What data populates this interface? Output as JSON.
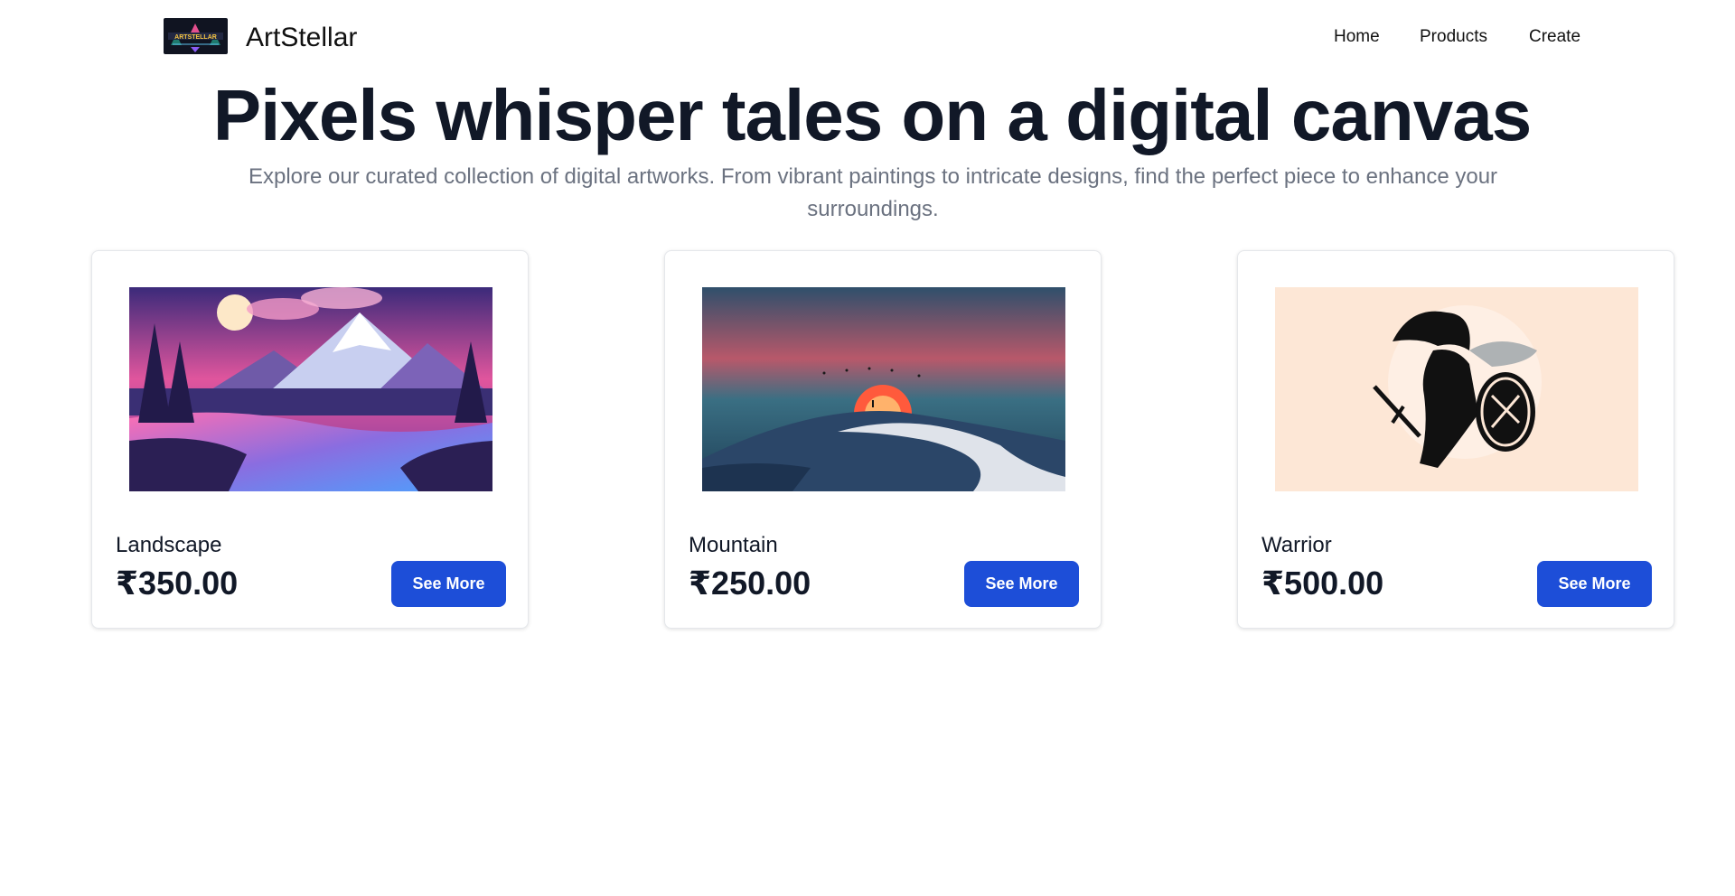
{
  "header": {
    "logo_icon": "artstellar-logo-icon",
    "logo_text": "ARTSTELLAR",
    "brand": "ArtStellar",
    "nav": {
      "home": "Home",
      "products": "Products",
      "create": "Create"
    }
  },
  "hero": {
    "title": "Pixels whisper tales on a digital canvas",
    "subtitle": "Explore our curated collection of digital artworks. From vibrant paintings to intricate designs, find the perfect piece to enhance your surroundings."
  },
  "products": [
    {
      "title": "Landscape",
      "price": "₹350.00",
      "button": "See More",
      "image": "landscape-painting"
    },
    {
      "title": "Mountain",
      "price": "₹250.00",
      "button": "See More",
      "image": "mountain-sunset-painting"
    },
    {
      "title": "Warrior",
      "price": "₹500.00",
      "button": "See More",
      "image": "warrior-silhouette-painting"
    }
  ],
  "colors": {
    "accent": "#1d4ed8",
    "heading": "#111827",
    "muted": "#6b7280",
    "card_border": "#e5e7eb"
  }
}
